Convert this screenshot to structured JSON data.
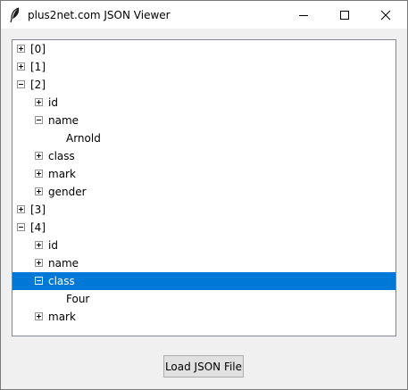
{
  "window": {
    "title": "plus2net.com JSON Viewer",
    "icon": "feather-icon"
  },
  "tree": {
    "nodes": [
      {
        "label": "[0]",
        "level": 0,
        "state": "collapsed"
      },
      {
        "label": "[1]",
        "level": 0,
        "state": "collapsed"
      },
      {
        "label": "[2]",
        "level": 0,
        "state": "expanded"
      },
      {
        "label": "id",
        "level": 1,
        "state": "collapsed"
      },
      {
        "label": "name",
        "level": 1,
        "state": "expanded"
      },
      {
        "label": "Arnold",
        "level": 2,
        "state": "leaf"
      },
      {
        "label": "class",
        "level": 1,
        "state": "collapsed"
      },
      {
        "label": "mark",
        "level": 1,
        "state": "collapsed"
      },
      {
        "label": "gender",
        "level": 1,
        "state": "collapsed"
      },
      {
        "label": "[3]",
        "level": 0,
        "state": "collapsed"
      },
      {
        "label": "[4]",
        "level": 0,
        "state": "expanded"
      },
      {
        "label": "id",
        "level": 1,
        "state": "collapsed"
      },
      {
        "label": "name",
        "level": 1,
        "state": "collapsed"
      },
      {
        "label": "class",
        "level": 1,
        "state": "expanded",
        "selected": true
      },
      {
        "label": "Four",
        "level": 2,
        "state": "leaf"
      },
      {
        "label": "mark",
        "level": 1,
        "state": "collapsed"
      }
    ]
  },
  "buttons": {
    "load_label": "Load JSON File"
  },
  "colors": {
    "selection": "#0078d7",
    "expander_border": "#919191"
  }
}
